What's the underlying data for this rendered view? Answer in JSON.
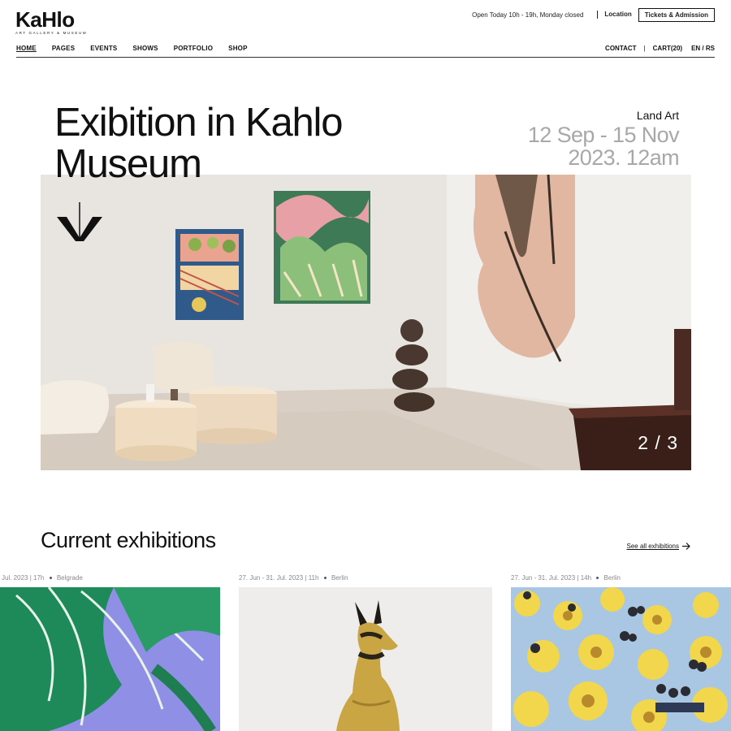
{
  "brand": {
    "name": "KaHlo",
    "tagline": "ART GALLERY & MUSEUM"
  },
  "topbar": {
    "hours": "Open Today 10h - 19h, Monday closed",
    "location": "Location",
    "tickets": "Tickets & Admission"
  },
  "nav": {
    "items": [
      "HOME",
      "PAGES",
      "EVENTS",
      "SHOWS",
      "PORTFOLIO",
      "SHOP"
    ],
    "contact": "CONTACT",
    "separator": "|",
    "cart": "CART(20)",
    "language": "EN / RS"
  },
  "hero": {
    "title": "Exibition in Kahlo Museum",
    "category": "Land Art",
    "date_line1": "12 Sep - 15 Nov",
    "date_line2": "2023. 12am",
    "slide_counter": "2 / 3"
  },
  "exhibitions": {
    "title": "Current exhibitions",
    "see_all": "See all exhibitions",
    "cards": [
      {
        "date": "Jul. 2023",
        "time": "17h",
        "city": "Belgrade"
      },
      {
        "date": "27. Jun - 31. Jul. 2023",
        "time": "11h",
        "city": "Berlin"
      },
      {
        "date": "27. Jun - 31. Jul. 2023",
        "time": "14h",
        "city": "Berlin"
      }
    ]
  },
  "colors": {
    "text": "#111111",
    "muted_date": "#a8a8a8",
    "meta": "#888888",
    "background": "#ffffff"
  },
  "icons": {
    "down_arrow": "chevron-down-arrow-icon",
    "see_all_arrow": "arrow-right-icon"
  }
}
